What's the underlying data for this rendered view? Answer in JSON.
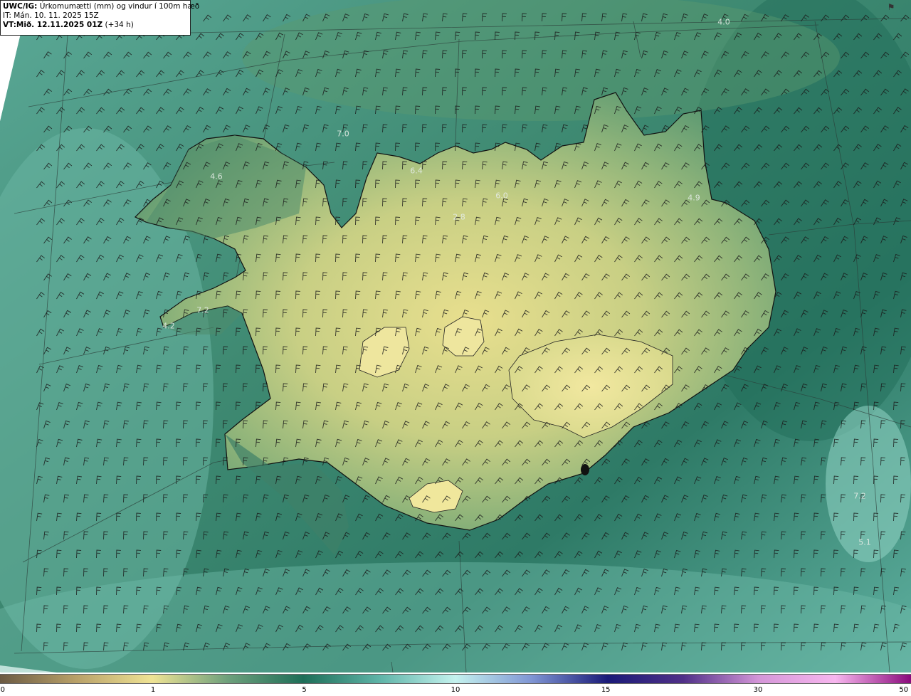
{
  "header": {
    "model": "UWC/IG:",
    "title": " Úrkomumætti (mm) og vindur í 100m hæð",
    "it_label": "IT:",
    "it_value": " Mán. 10. 11. 2025 15Z",
    "vt_label": "VT:",
    "vt_value": "Mið. 12.11.2025 01Z",
    "lead": " (+34 h)"
  },
  "legend": {
    "ticks": [
      "0",
      "1",
      "5",
      "10",
      "15",
      "30",
      "50"
    ],
    "tick_values": [
      0,
      1,
      5,
      10,
      15,
      30,
      50
    ],
    "colors": [
      "#6b5a43",
      "#b8a068",
      "#efe394",
      "#6ea07c",
      "#1e6e58",
      "#5fb4a8",
      "#c4f2ee",
      "#8096d4",
      "#1a1a78",
      "#503088",
      "#d496d8",
      "#f7b6ee",
      "#8a0a7c"
    ]
  },
  "value_labels": [
    {
      "text": "4.0"
    },
    {
      "text": "7.0"
    },
    {
      "text": "4.6"
    },
    {
      "text": "6.4"
    },
    {
      "text": "6.0"
    },
    {
      "text": "4.9"
    },
    {
      "text": "2.8"
    },
    {
      "text": "7.2"
    },
    {
      "text": "4.2"
    },
    {
      "text": "7.2"
    },
    {
      "text": "5.1"
    }
  ],
  "icons": {
    "corner": "wind-barb-icon"
  }
}
